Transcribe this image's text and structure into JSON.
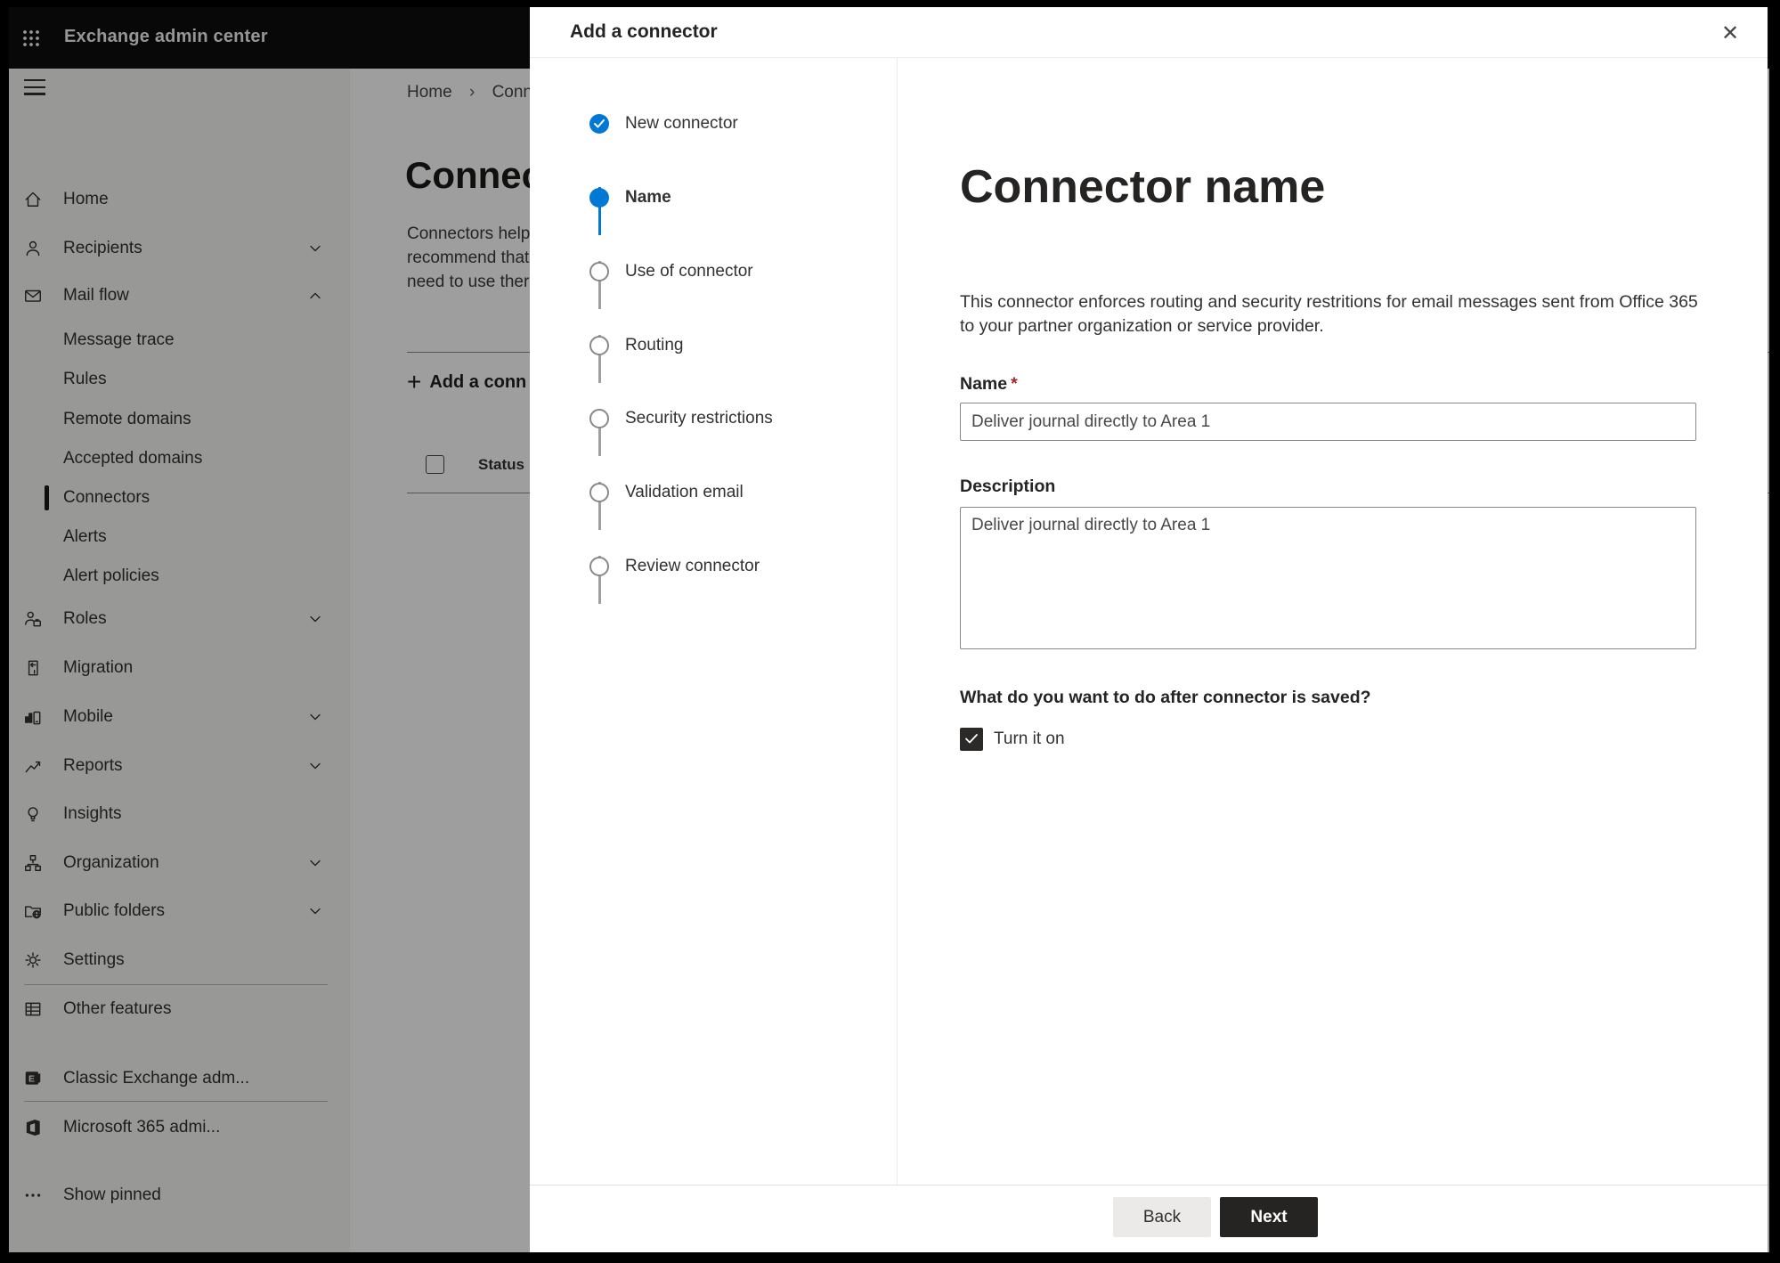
{
  "colors": {
    "accent": "#0078d4",
    "required": "#a4262c",
    "selected_indicator": "#1b1a19"
  },
  "topbar": {
    "app_name": "Exchange admin center"
  },
  "sidebar": {
    "items": [
      {
        "label": "Home",
        "icon": "home-icon"
      },
      {
        "label": "Recipients",
        "icon": "person-icon",
        "chevron": "down"
      },
      {
        "label": "Mail flow",
        "icon": "mail-icon",
        "chevron": "up",
        "expanded": true
      },
      {
        "label": "Message trace",
        "indent": true
      },
      {
        "label": "Rules",
        "indent": true
      },
      {
        "label": "Remote domains",
        "indent": true
      },
      {
        "label": "Accepted domains",
        "indent": true
      },
      {
        "label": "Connectors",
        "indent": true,
        "selected": true
      },
      {
        "label": "Alerts",
        "indent": true
      },
      {
        "label": "Alert policies",
        "indent": true
      },
      {
        "label": "Roles",
        "icon": "roles-icon",
        "chevron": "down"
      },
      {
        "label": "Migration",
        "icon": "migration-icon"
      },
      {
        "label": "Mobile",
        "icon": "mobile-icon",
        "chevron": "down"
      },
      {
        "label": "Reports",
        "icon": "reports-icon",
        "chevron": "down"
      },
      {
        "label": "Insights",
        "icon": "lightbulb-icon"
      },
      {
        "label": "Organization",
        "icon": "org-chart-icon",
        "chevron": "down"
      },
      {
        "label": "Public folders",
        "icon": "folder-globe-icon",
        "chevron": "down"
      },
      {
        "label": "Settings",
        "icon": "gear-icon"
      },
      {
        "label": "Other features",
        "icon": "grid-icon"
      },
      {
        "label": "Classic Exchange adm...",
        "icon": "exchange-logo-icon"
      },
      {
        "label": "Microsoft 365 admi...",
        "icon": "office-logo-icon"
      },
      {
        "label": "Show pinned",
        "icon": "ellipsis-icon"
      }
    ]
  },
  "page": {
    "breadcrumb": {
      "home": "Home",
      "separator": "›",
      "current": "Conne"
    },
    "title": "Connec",
    "description_lines": [
      "Connectors help",
      "recommend that",
      "need to use ther"
    ],
    "add_button_label": "Add a conn",
    "table_header": "Status"
  },
  "dialog": {
    "title": "Add a connector",
    "steps": [
      {
        "label": "New connector",
        "state": "done"
      },
      {
        "label": "Name",
        "state": "active"
      },
      {
        "label": "Use of connector",
        "state": "todo"
      },
      {
        "label": "Routing",
        "state": "todo"
      },
      {
        "label": "Security restrictions",
        "state": "todo"
      },
      {
        "label": "Validation email",
        "state": "todo"
      },
      {
        "label": "Review connector",
        "state": "todo"
      }
    ],
    "content": {
      "heading": "Connector name",
      "intro_lines": [
        "This connector enforces routing and security restritions for email messages sent from Office 365",
        "to your partner organization or service provider."
      ],
      "name_label": "Name",
      "required_marker": "*",
      "name_value": "Deliver journal directly to Area 1",
      "description_label": "Description",
      "description_value": "Deliver journal directly to Area 1",
      "after_save_question": "What do you want to do after connector is saved?",
      "turn_on_label": "Turn it on",
      "turn_on_checked": true
    },
    "footer": {
      "back_label": "Back",
      "next_label": "Next"
    }
  }
}
